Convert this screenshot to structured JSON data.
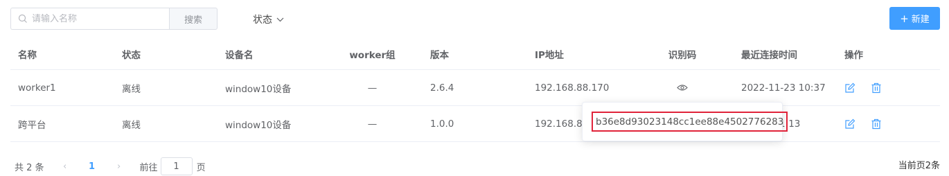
{
  "toolbar": {
    "search_placeholder": "请输入名称",
    "search_button": "搜索",
    "status_filter": "状态",
    "new_button": "新建",
    "colors": {
      "primary": "#409eff"
    }
  },
  "table": {
    "headers": {
      "name": "名称",
      "status": "状态",
      "device": "设备名",
      "group": "worker组",
      "version": "版本",
      "ip": "IP地址",
      "code": "识别码",
      "last_connect": "最近连接时间",
      "ops": "操作"
    },
    "rows": [
      {
        "name": "worker1",
        "status": "离线",
        "device": "window10设备",
        "group": "—",
        "version": "2.6.4",
        "ip": "192.168.88.170",
        "last_connect": "2022-11-23 10:37"
      },
      {
        "name": "跨平台",
        "status": "离线",
        "device": "window10设备",
        "group": "—",
        "version": "1.0.0",
        "ip": "192.168.88",
        "last_connect": "24 11:13"
      }
    ]
  },
  "popover": {
    "code": "b36e8d93023148cc1ee88e4502776283",
    "highlight_color": "#e0233a"
  },
  "pagination": {
    "total": "共 2 条",
    "prev": "‹",
    "page": "1",
    "next": "›",
    "goto": "前往",
    "goto_value": "1",
    "page_suffix": "页",
    "current_count": "当前页2条"
  }
}
